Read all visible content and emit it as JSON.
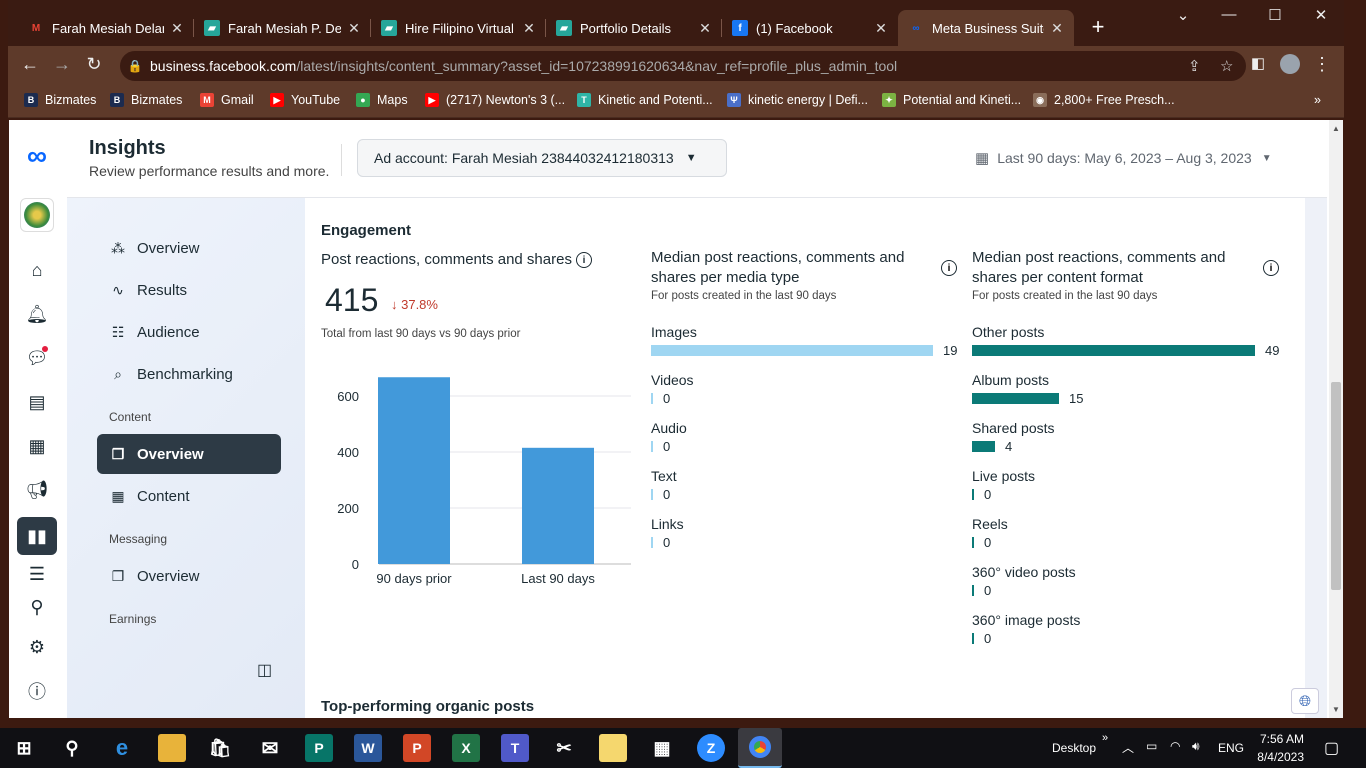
{
  "browser": {
    "tabs": [
      {
        "title": "Farah Mesiah Delanta",
        "icon": "gmail-icon",
        "color": "#ea4335",
        "glyph": "M"
      },
      {
        "title": "Farah Mesiah P. Dela",
        "icon": "tile-icon",
        "color": "#26a69a",
        "glyph": "▰"
      },
      {
        "title": "Hire Filipino Virtual A",
        "icon": "tile-icon",
        "color": "#26a69a",
        "glyph": "▰"
      },
      {
        "title": "Portfolio Details",
        "icon": "tile-icon",
        "color": "#26a69a",
        "glyph": "▰"
      },
      {
        "title": "(1) Facebook",
        "icon": "facebook-icon",
        "color": "#1877f2",
        "glyph": "f"
      },
      {
        "title": "Meta Business Suite",
        "icon": "meta-icon",
        "color": "#0866ff",
        "glyph": "∞"
      }
    ],
    "url_host": "business.facebook.com",
    "url_path": "/latest/insights/content_summary?asset_id=107238991620634&nav_ref=profile_plus_admin_tool",
    "bookmarks": [
      {
        "label": "Bizmates",
        "glyph": "B",
        "color": "#1c2b4f"
      },
      {
        "label": "Bizmates",
        "glyph": "B",
        "color": "#1c2b4f"
      },
      {
        "label": "Gmail",
        "glyph": "M",
        "color": "#ea4335"
      },
      {
        "label": "YouTube",
        "glyph": "▶",
        "color": "#ff0000"
      },
      {
        "label": "Maps",
        "glyph": "●",
        "color": "#34a853"
      },
      {
        "label": "(2717) Newton's 3 (...",
        "glyph": "▶",
        "color": "#ff0000"
      },
      {
        "label": "Kinetic and Potenti...",
        "glyph": "T",
        "color": "#2fb5a7"
      },
      {
        "label": "kinetic energy | Defi...",
        "glyph": "Ψ",
        "color": "#4a6fc9"
      },
      {
        "label": "Potential and Kineti...",
        "glyph": "✦",
        "color": "#7cb342"
      },
      {
        "label": "2,800+ Free Presch...",
        "glyph": "◉",
        "color": "#8a6d5a"
      }
    ]
  },
  "header": {
    "title": "Insights",
    "subtitle": "Review performance results and more.",
    "ad_account": "Ad account: Farah Mesiah 23844032412180313",
    "date_range": "Last 90 days: May 6, 2023 – Aug 3, 2023"
  },
  "sidenav": {
    "items": [
      {
        "label": "Overview",
        "icon": "network-icon",
        "glyph": "⁂"
      },
      {
        "label": "Results",
        "icon": "trend-icon",
        "glyph": "∿"
      },
      {
        "label": "Audience",
        "icon": "people-icon",
        "glyph": "☷"
      },
      {
        "label": "Benchmarking",
        "icon": "search-list-icon",
        "glyph": "⌕"
      }
    ],
    "content_section": "Content",
    "content_items": [
      {
        "label": "Overview",
        "icon": "layers-icon",
        "glyph": "❐"
      },
      {
        "label": "Content",
        "icon": "table-icon",
        "glyph": "▦"
      }
    ],
    "messaging_section": "Messaging",
    "messaging_items": [
      {
        "label": "Overview",
        "icon": "layers-icon",
        "glyph": "❐"
      }
    ],
    "earnings_section": "Earnings"
  },
  "engagement": {
    "heading": "Engagement",
    "metric_label": "Post reactions, comments and shares",
    "total": "415",
    "change": "↓ 37.8%",
    "caption": "Total from last 90 days vs 90 days prior",
    "media_type_title": "Median post reactions, comments and shares per media type",
    "media_type_sub": "For posts created in the last 90 days",
    "format_title": "Median post reactions, comments and shares per content format",
    "format_sub": "For posts created in the last 90 days"
  },
  "chart_data": {
    "type": "bar",
    "categories": [
      "90 days prior",
      "Last 90 days"
    ],
    "values": [
      667,
      415
    ],
    "ylim": [
      0,
      700
    ],
    "yticks": [
      0,
      200,
      400,
      600
    ],
    "color": "#4299da"
  },
  "media_types": [
    {
      "label": "Images",
      "value": 19
    },
    {
      "label": "Videos",
      "value": 0
    },
    {
      "label": "Audio",
      "value": 0
    },
    {
      "label": "Text",
      "value": 0
    },
    {
      "label": "Links",
      "value": 0
    }
  ],
  "content_formats": [
    {
      "label": "Other posts",
      "value": 49
    },
    {
      "label": "Album posts",
      "value": 15
    },
    {
      "label": "Shared posts",
      "value": 4
    },
    {
      "label": "Live posts",
      "value": 0
    },
    {
      "label": "Reels",
      "value": 0
    },
    {
      "label": "360° video posts",
      "value": 0
    },
    {
      "label": "360° image posts",
      "value": 0
    }
  ],
  "colors": {
    "media_bar": "#9fd6f2",
    "format_bar": "#0b7a77"
  },
  "top_posts_heading": "Top-performing organic posts",
  "taskbar": {
    "desktop_label": "Desktop",
    "lang": "ENG",
    "time": "7:56 AM",
    "date": "8/4/2023"
  }
}
